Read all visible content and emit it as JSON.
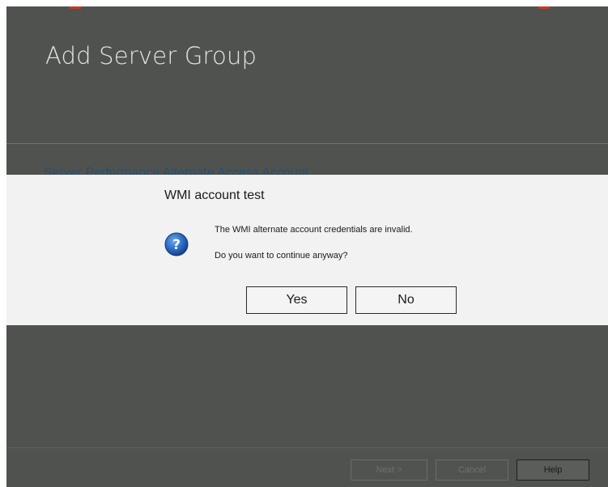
{
  "wizard": {
    "title": "Add Server Group",
    "section_title": "Server Performance Alternate Access Account",
    "footer": {
      "next_label": "Next >",
      "cancel_label": "Cancel",
      "help_label": "Help"
    }
  },
  "dialog": {
    "title": "WMI account test",
    "icon": "question-icon",
    "message_line1": "The WMI alternate account credentials are invalid.",
    "message_line2": "Do you want to continue anyway?",
    "yes_label": "Yes",
    "no_label": "No"
  },
  "colors": {
    "overlay": "#4f524f",
    "dialog_background": "#f2f2f2",
    "icon_blue": "#1f5fbf"
  }
}
